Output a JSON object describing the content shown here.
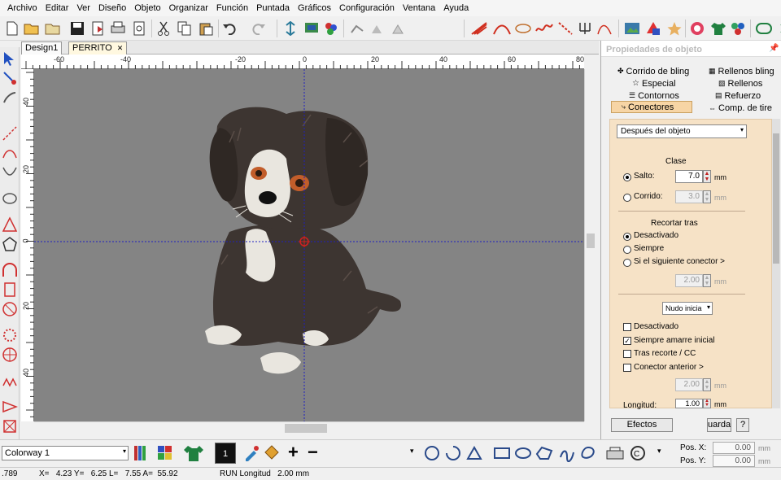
{
  "menu": [
    "Archivo",
    "Editar",
    "Ver",
    "Diseño",
    "Objeto",
    "Organizar",
    "Función",
    "Puntada",
    "Gráficos",
    "Configuración",
    "Ventana",
    "Ayuda"
  ],
  "tabs": [
    "Design1",
    "PERRITO"
  ],
  "tab_close": "✕",
  "ruler": {
    "h": [
      "-60",
      "-40",
      "-20",
      "0",
      "20",
      "40",
      "60",
      "80"
    ],
    "v": [
      "40",
      "20",
      "0",
      "20",
      "40"
    ]
  },
  "panel": {
    "title": "Propiedades de objeto",
    "tabs": [
      "Corrido de bling",
      "Rellenos bling",
      "Especial",
      "Rellenos",
      "Contornos",
      "Refuerzo",
      "Conectores",
      "Comp. de tire"
    ],
    "active_tab": "Conectores",
    "after_select": "Después del objeto",
    "clase_heading": "Clase",
    "salto_label": "Salto:",
    "salto_value": "7.0",
    "corrido_label": "Corrido:",
    "corrido_value": "3.0",
    "unit": "mm",
    "recortar_heading": "Recortar tras",
    "desactivado_radio": "Desactivado",
    "siempre_radio": "Siempre",
    "si_siguiente": "Si el siguiente conector >",
    "si_value": "2.00",
    "nudo_select": "Nudo inicia",
    "chk_desactivado": "Desactivado",
    "chk_siempre_amarre": "Siempre amarre inicial",
    "chk_tras_recorte": "Tras recorte / CC",
    "chk_conector_anterior": "Conector anterior >",
    "anterior_value": "2.00",
    "longitud_label": "Longitud:",
    "longitud_value": "1.00",
    "efectos_btn": "Efectos",
    "guardar_btn": "uarda",
    "help_btn": "?"
  },
  "bottom": {
    "colorway": "Colorway 1",
    "color_number": "1",
    "pos_x_label": "Pos. X:",
    "pos_x_value": "0.00",
    "pos_y_label": "Pos. Y:",
    "pos_y_value": "0.00",
    "unit": "mm"
  },
  "status": {
    "left": ".789",
    "coords": "X=   4.23 Y=   6.25 L=   7.55 A=  55.92",
    "run": "RUN Longitud   2.00 mm"
  },
  "colors": {
    "canvas": "#848484",
    "guide": "#2020c0",
    "panel_form": "#f6e2c6",
    "active_tab": "#f7d5a5",
    "dog_fur": "#3d3531",
    "dog_white": "#e9e6df",
    "eye": "#c25d2a"
  }
}
